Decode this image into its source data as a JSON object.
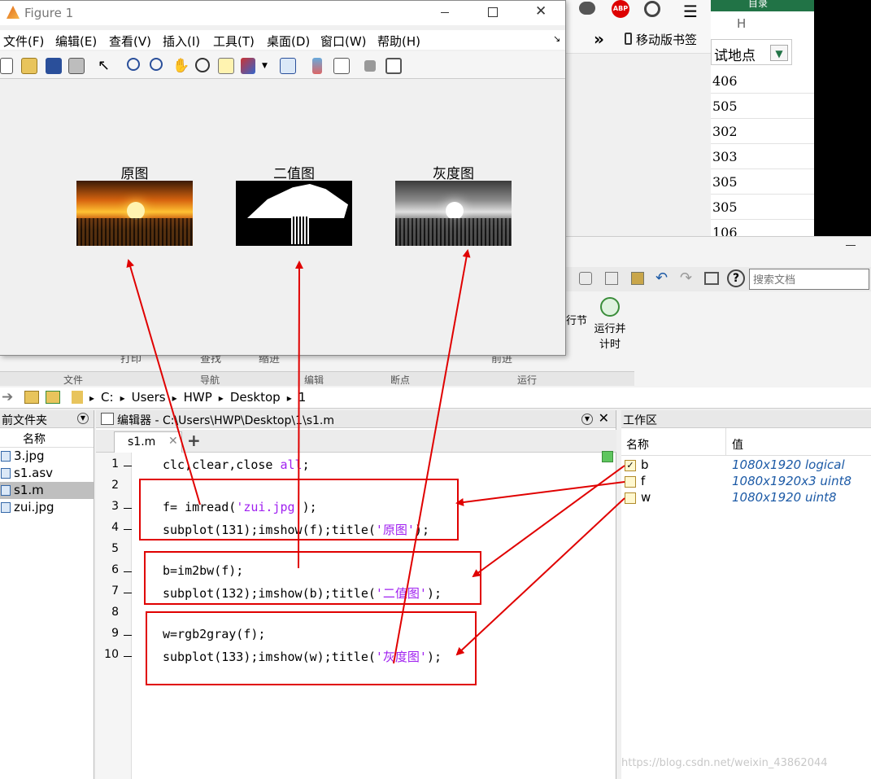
{
  "figure": {
    "title": "Figure 1",
    "menu": [
      "文件(F)",
      "编辑(E)",
      "查看(V)",
      "插入(I)",
      "工具(T)",
      "桌面(D)",
      "窗口(W)",
      "帮助(H)"
    ],
    "subplots": [
      {
        "title": "原图"
      },
      {
        "title": "二值图"
      },
      {
        "title": "灰度图"
      }
    ]
  },
  "browser": {
    "bookmark_label": "移动版书签",
    "more_label": "»"
  },
  "excel": {
    "header_letter": "H",
    "top_label": "目录",
    "column_header": "试地点",
    "rows": [
      "406",
      "505",
      "302",
      "303",
      "305",
      "305",
      "106"
    ]
  },
  "matlab": {
    "search_placeholder": "搜索文档",
    "ribbon_groups": [
      "文件",
      "导航",
      "编辑",
      "断点",
      "运行"
    ],
    "ribbon_buttons": {
      "print": "打印",
      "find": "查找",
      "indent": "缩进",
      "advance": "前进",
      "run_section": "行节",
      "run_time": "运行并\n计时"
    },
    "path": [
      "C:",
      "Users",
      "HWP",
      "Desktop",
      "1"
    ],
    "files_pane": {
      "title": "前文件夹",
      "name_header": "名称",
      "files": [
        "3.jpg",
        "s1.asv",
        "s1.m",
        "zui.jpg"
      ]
    },
    "editor": {
      "title": "编辑器 - C:\\Users\\HWP\\Desktop\\1\\s1.m",
      "tab": "s1.m",
      "lines": [
        {
          "num": "1",
          "text": "clc,clear,close all;"
        },
        {
          "num": "2",
          "text": ""
        },
        {
          "num": "3",
          "pre": "f= imread(",
          "str": "'zui.jpg'",
          "post": ");"
        },
        {
          "num": "4",
          "pre": "subplot(131);imshow(f);title(",
          "str": "'原图'",
          "post": ");"
        },
        {
          "num": "5",
          "text": ""
        },
        {
          "num": "6",
          "text": "b=im2bw(f);"
        },
        {
          "num": "7",
          "pre": "subplot(132);imshow(b);title(",
          "str": "'二值图'",
          "post": ");"
        },
        {
          "num": "8",
          "text": ""
        },
        {
          "num": "9",
          "text": "w=rgb2gray(f);"
        },
        {
          "num": "10",
          "pre": "subplot(133);imshow(w);title(",
          "str": "'灰度图'",
          "post": ");"
        }
      ]
    },
    "workspace": {
      "title": "工作区",
      "name_header": "名称",
      "value_header": "值",
      "vars": [
        {
          "name": "b",
          "value": "1080x1920 logical"
        },
        {
          "name": "f",
          "value": "1080x1920x3 uint8"
        },
        {
          "name": "w",
          "value": "1080x1920 uint8"
        }
      ]
    },
    "watermark": "https://blog.csdn.net/weixin_43862044"
  },
  "colors": {
    "annotation": "#e00000",
    "string": "#a020f0",
    "ws_value": "#1c5aa6",
    "excel_green": "#217346"
  }
}
